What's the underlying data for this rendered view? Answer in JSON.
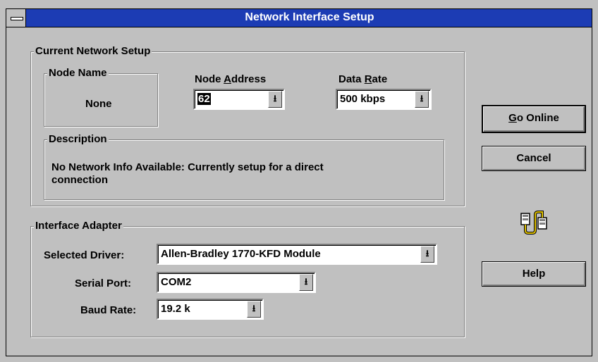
{
  "window": {
    "title": "Network Interface Setup"
  },
  "current_setup": {
    "legend": "Current Network Setup",
    "node_name": {
      "legend": "Node Name",
      "value": "None"
    },
    "node_address": {
      "label_pre": "Node ",
      "label_u": "A",
      "label_post": "ddress",
      "value": "62"
    },
    "data_rate": {
      "label_pre": "Data ",
      "label_u": "R",
      "label_post": "ate",
      "value": "500 kbps"
    },
    "description": {
      "legend": "Description",
      "text_line1": "No Network Info Available:  Currently setup for a direct",
      "text_line2": "connection"
    }
  },
  "interface_adapter": {
    "legend": "Interface Adapter",
    "selected_driver": {
      "label": "Selected Driver:",
      "value": "Allen-Bradley 1770-KFD Module"
    },
    "serial_port": {
      "label": "Serial Port:",
      "value": "COM2"
    },
    "baud_rate": {
      "label": "Baud Rate:",
      "value": "19.2 k"
    }
  },
  "buttons": {
    "go_online_u": "G",
    "go_online_rest": "o Online",
    "cancel": "Cancel",
    "help": "Help"
  },
  "icons": {
    "connection": "network-cable-icon",
    "dropdown": "dropdown-arrow-icon",
    "system_menu": "system-menu-icon"
  },
  "colors": {
    "titlebar": "#1c3cb4",
    "face": "#c0c0c0"
  }
}
